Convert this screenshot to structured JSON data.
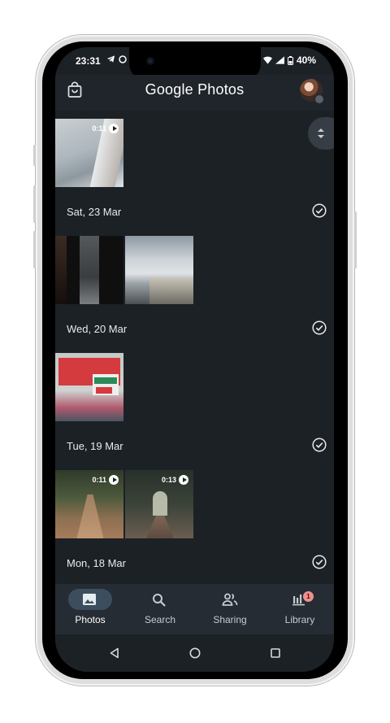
{
  "status_bar": {
    "time": "23:31",
    "battery": "40%"
  },
  "app_bar": {
    "title_brand": "Google",
    "title_product": "Photos"
  },
  "groups": [
    {
      "date": "Sat, 23 Mar",
      "thumbs": [
        {
          "duration": "0:11"
        }
      ]
    },
    {
      "date": "Wed, 20 Mar",
      "thumbs": [
        {},
        {}
      ]
    },
    {
      "date": "Tue, 19 Mar",
      "thumbs": [
        {}
      ]
    },
    {
      "date": "Mon, 18 Mar",
      "thumbs": [
        {
          "duration": "0:11"
        },
        {
          "duration": "0:13"
        }
      ]
    }
  ],
  "bottom_nav": {
    "items": [
      {
        "label": "Photos",
        "icon": "photos-icon",
        "active": true
      },
      {
        "label": "Search",
        "icon": "search-icon"
      },
      {
        "label": "Sharing",
        "icon": "sharing-icon"
      },
      {
        "label": "Library",
        "icon": "library-icon",
        "badge": "1"
      }
    ]
  },
  "colors": {
    "background": "#1c2126",
    "app_bar": "#1f252b",
    "nav": "#252c33",
    "active_pill": "#3c4e5e",
    "badge": "#f08f8f"
  }
}
